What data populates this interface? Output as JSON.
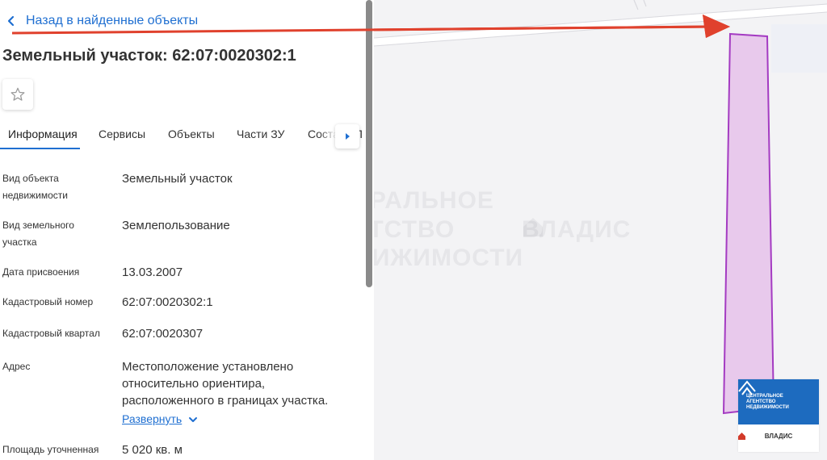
{
  "nav": {
    "back_label": "Назад в найденные объекты"
  },
  "page": {
    "title": "Земельный участок: 62:07:0020302:1"
  },
  "tabs": [
    {
      "label": "Информация"
    },
    {
      "label": "Сервисы"
    },
    {
      "label": "Объекты"
    },
    {
      "label": "Части ЗУ"
    },
    {
      "label": "Состав ГП"
    }
  ],
  "info": {
    "object_type": {
      "label_1": "Вид объекта",
      "label_2": "недвижимости",
      "value": "Земельный участок"
    },
    "land_type": {
      "label_1": "Вид земельного",
      "label_2": "участка",
      "value": "Землепользование"
    },
    "assign_date": {
      "label": "Дата присвоения",
      "value": "13.03.2007"
    },
    "cad_number": {
      "label": "Кадастровый номер",
      "value": "62:07:0020302:1"
    },
    "cad_quarter": {
      "label": "Кадастровый квартал",
      "value": "62:07:0020307"
    },
    "address": {
      "label": "Адрес",
      "line_1": "Местоположение установлено",
      "line_2": "относительно ориентира,",
      "line_3": "расположенного в границах участка.",
      "expand": "Развернуть"
    },
    "area": {
      "label": "Площадь уточненная",
      "value": "5 020 кв. м"
    }
  },
  "watermark": {
    "line_1": "ЦЕНТРАЛЬНОЕ",
    "line_2": "АГЕНТСТВО",
    "line_3": "НЕДВИЖИМОСТИ",
    "brand": "ВЛАДИС"
  },
  "logo": {
    "line_1": "ЦЕНТРАЛЬНОЕ",
    "line_2": "АГЕНТСТВО",
    "line_3": "НЕДВИЖИМОСТИ",
    "brand": "ВЛАДИС"
  },
  "colors": {
    "accent": "#1f6fd1",
    "parcel_fill": "#e8c9ec",
    "parcel_stroke": "#a43bc2",
    "arrow": "#e0412d",
    "logo_blue": "#1d6bbf"
  },
  "icons": {
    "back": "chevron-left-icon",
    "favorite": "star-icon",
    "tab_scroll": "caret-right-icon",
    "expand": "chevron-down-icon"
  }
}
